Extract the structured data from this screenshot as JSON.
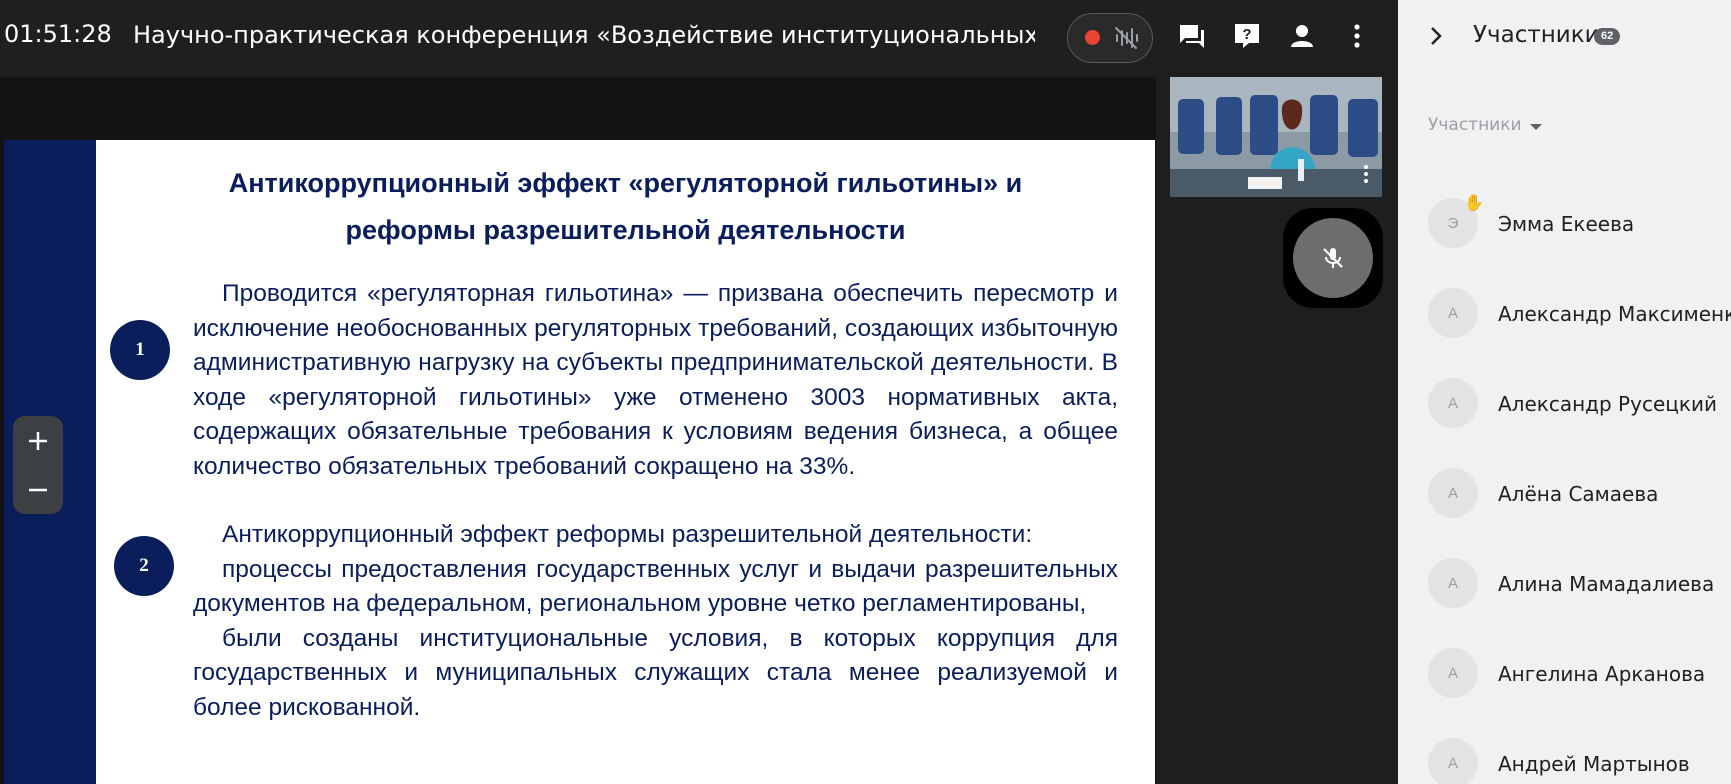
{
  "header": {
    "timer": "01:51:28",
    "title": "Научно-практическая конференция «Воздействие институциональных реф"
  },
  "slide": {
    "title_line1": "Антикоррупционный эффект «регуляторной гильотины» и",
    "title_line2": "реформы разрешительной деятельности",
    "point1_number": "1",
    "point1_text": "Проводится «регуляторная гильотина» — призвана обеспечить пересмотр и исключение необоснованных регуляторных требований, создающих избыточную административную нагрузку на субъекты предпринимательской деятельности. В ходе «регуляторной гильотины» уже отменено 3003 нормативных акта, содержащих обязательные требования к условиям ведения бизнеса, а общее количество обязательных требований сокращено на 33%.",
    "point2_number": "2",
    "point2_p1": "Антикоррупционный эффект реформы разрешительной деятельности:",
    "point2_p2": "процессы предоставления государственных услуг и выдачи разрешительных документов на федеральном, региональном уровне четко регламентированы,",
    "point2_p3": "были созданы институциональные условия, в которых коррупция для государственных и муниципальных служащих стала менее реализуемой и более рискованной."
  },
  "zoom": {
    "plus": "+",
    "minus": "—"
  },
  "participants": {
    "title": "Участники",
    "count": "62",
    "filter_label": "Участники",
    "items": [
      {
        "initial": "Э",
        "name": "Эмма Екеева",
        "hand": "✋"
      },
      {
        "initial": "А",
        "name": "Александр Максименко"
      },
      {
        "initial": "А",
        "name": "Александр Русецкий"
      },
      {
        "initial": "А",
        "name": "Алёна Самаева"
      },
      {
        "initial": "А",
        "name": "Алина Мамадалиева"
      },
      {
        "initial": "А",
        "name": "Ангелина Арканова"
      },
      {
        "initial": "А",
        "name": "Андрей Мартынов"
      }
    ]
  },
  "icons": {
    "record": "record-icon",
    "noise_cancel": "noise-cancel-icon",
    "chat": "chat-icon",
    "help": "help-icon",
    "participants": "person-icon",
    "more": "more-vert-icon",
    "mic_off": "mic-off-icon",
    "collapse": "chevron-right-icon"
  },
  "colors": {
    "slide_navy": "#0b1e5c",
    "record_red": "#ea4335",
    "panel_bg": "#f1f1f1",
    "topbar_bg": "#1f1f1f"
  }
}
